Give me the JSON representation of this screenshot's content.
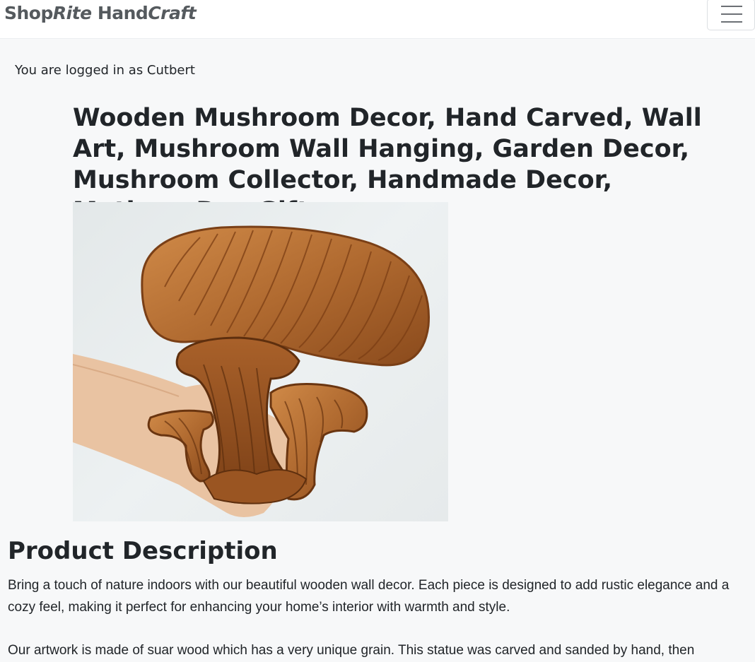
{
  "navbar": {
    "brand": {
      "part1": "Shop",
      "part2": "Rite",
      "part3": "Hand",
      "part4": "Craft"
    },
    "menu_icon": "hamburger-menu-icon"
  },
  "login_status": "You are logged in as Cutbert",
  "product": {
    "title": "Wooden Mushroom Decor, Hand Carved, Wall Art, Mushroom Wall Hanging, Garden Decor, Mushroom Collector, Handmade Decor, Mothers Day Gift"
  },
  "description": {
    "heading": "Product Description",
    "paragraphs": [
      "Bring a touch of nature indoors with our beautiful wooden wall decor. Each piece is designed to add rustic elegance and a cozy feel, making it perfect for enhancing your home’s interior with warmth and style.",
      "Our artwork is made of suar wood which has a very unique grain. This statue was carved and sanded by hand, then"
    ]
  },
  "colors": {
    "page_bg": "#f7f8f9",
    "navbar_bg": "#ffffff",
    "brand_text": "#555a5e",
    "body_text": "#212529",
    "wood_dark": "#8a4a1c",
    "wood_light": "#c98446"
  }
}
